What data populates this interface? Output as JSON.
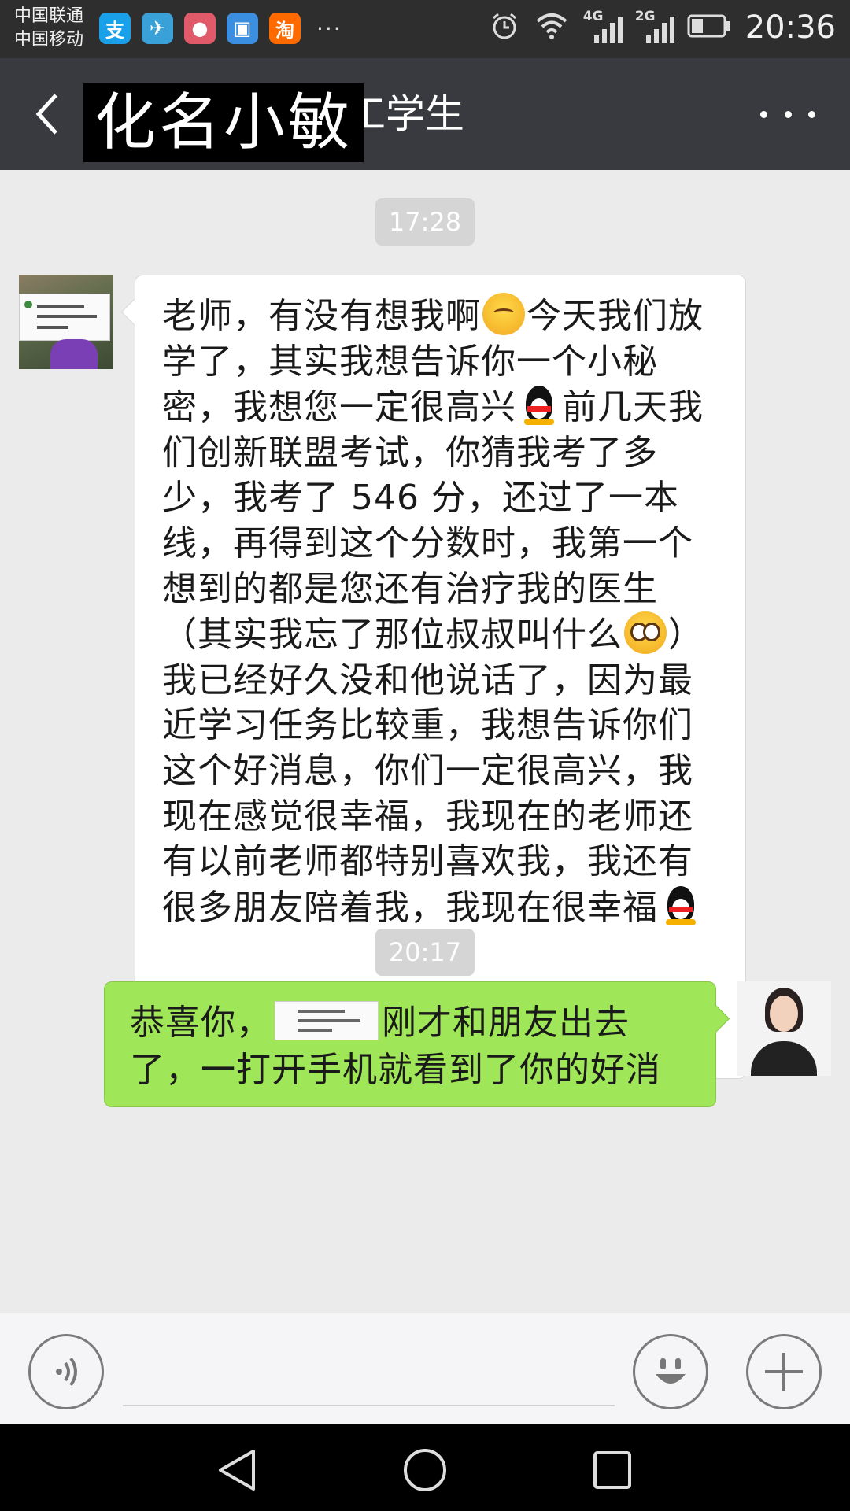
{
  "status_bar": {
    "carrier_1": "中国联通",
    "carrier_2": "中国移动",
    "app_icons": [
      {
        "icon": "alipay-icon",
        "glyph": "支",
        "color": "#1aa0e8"
      },
      {
        "icon": "paper-plane-icon",
        "glyph": "✈",
        "color": "#3aa0d8"
      },
      {
        "icon": "security-app-icon",
        "glyph": "●",
        "color": "#e05a6a"
      },
      {
        "icon": "gallery-icon",
        "glyph": "▣",
        "color": "#3b8fe0"
      },
      {
        "icon": "taobao-icon",
        "glyph": "淘",
        "color": "#ff6a00"
      }
    ],
    "more_apps": "···",
    "network_1": "4G",
    "network_2": "2G",
    "time": "20:36"
  },
  "header": {
    "redacted_name": "化名小敏",
    "title_suffix": "工学生"
  },
  "chat": {
    "time_1": "17:28",
    "message_1": {
      "p1": "老师，有没有想我啊",
      "p2": "今天我们放学了，其实我想告诉你一个小秘密，我想您一定很高兴",
      "p3": "前几天我们创新联盟考试，你猜我考了多少，我考了 546 分，还过了一本线，再得到这个分数时，我第一个想到的都是您还有治疗我的医生（其实我忘了那位叔叔叫什么",
      "p4": "）我已经好久没和他说话了，因为最近学习任务比较重，我想告诉你们这个好消息，你们一定很高兴，我现在感觉很幸福，我现在的老师还有以前老师都特别喜欢我，我还有很多朋友陪着我，我现在很幸福"
    },
    "time_2": "20:17",
    "message_2": {
      "p1": "恭喜你，",
      "p2": "刚才和朋友出去了，一打开手机就看到了你的好消"
    }
  },
  "input": {
    "placeholder": ""
  },
  "colors": {
    "status_bar": "#2e2e2e",
    "title_bar": "#393a3f",
    "chat_bg": "#ebebeb",
    "bubble_sent": "#9fe658",
    "bubble_received": "#ffffff"
  }
}
